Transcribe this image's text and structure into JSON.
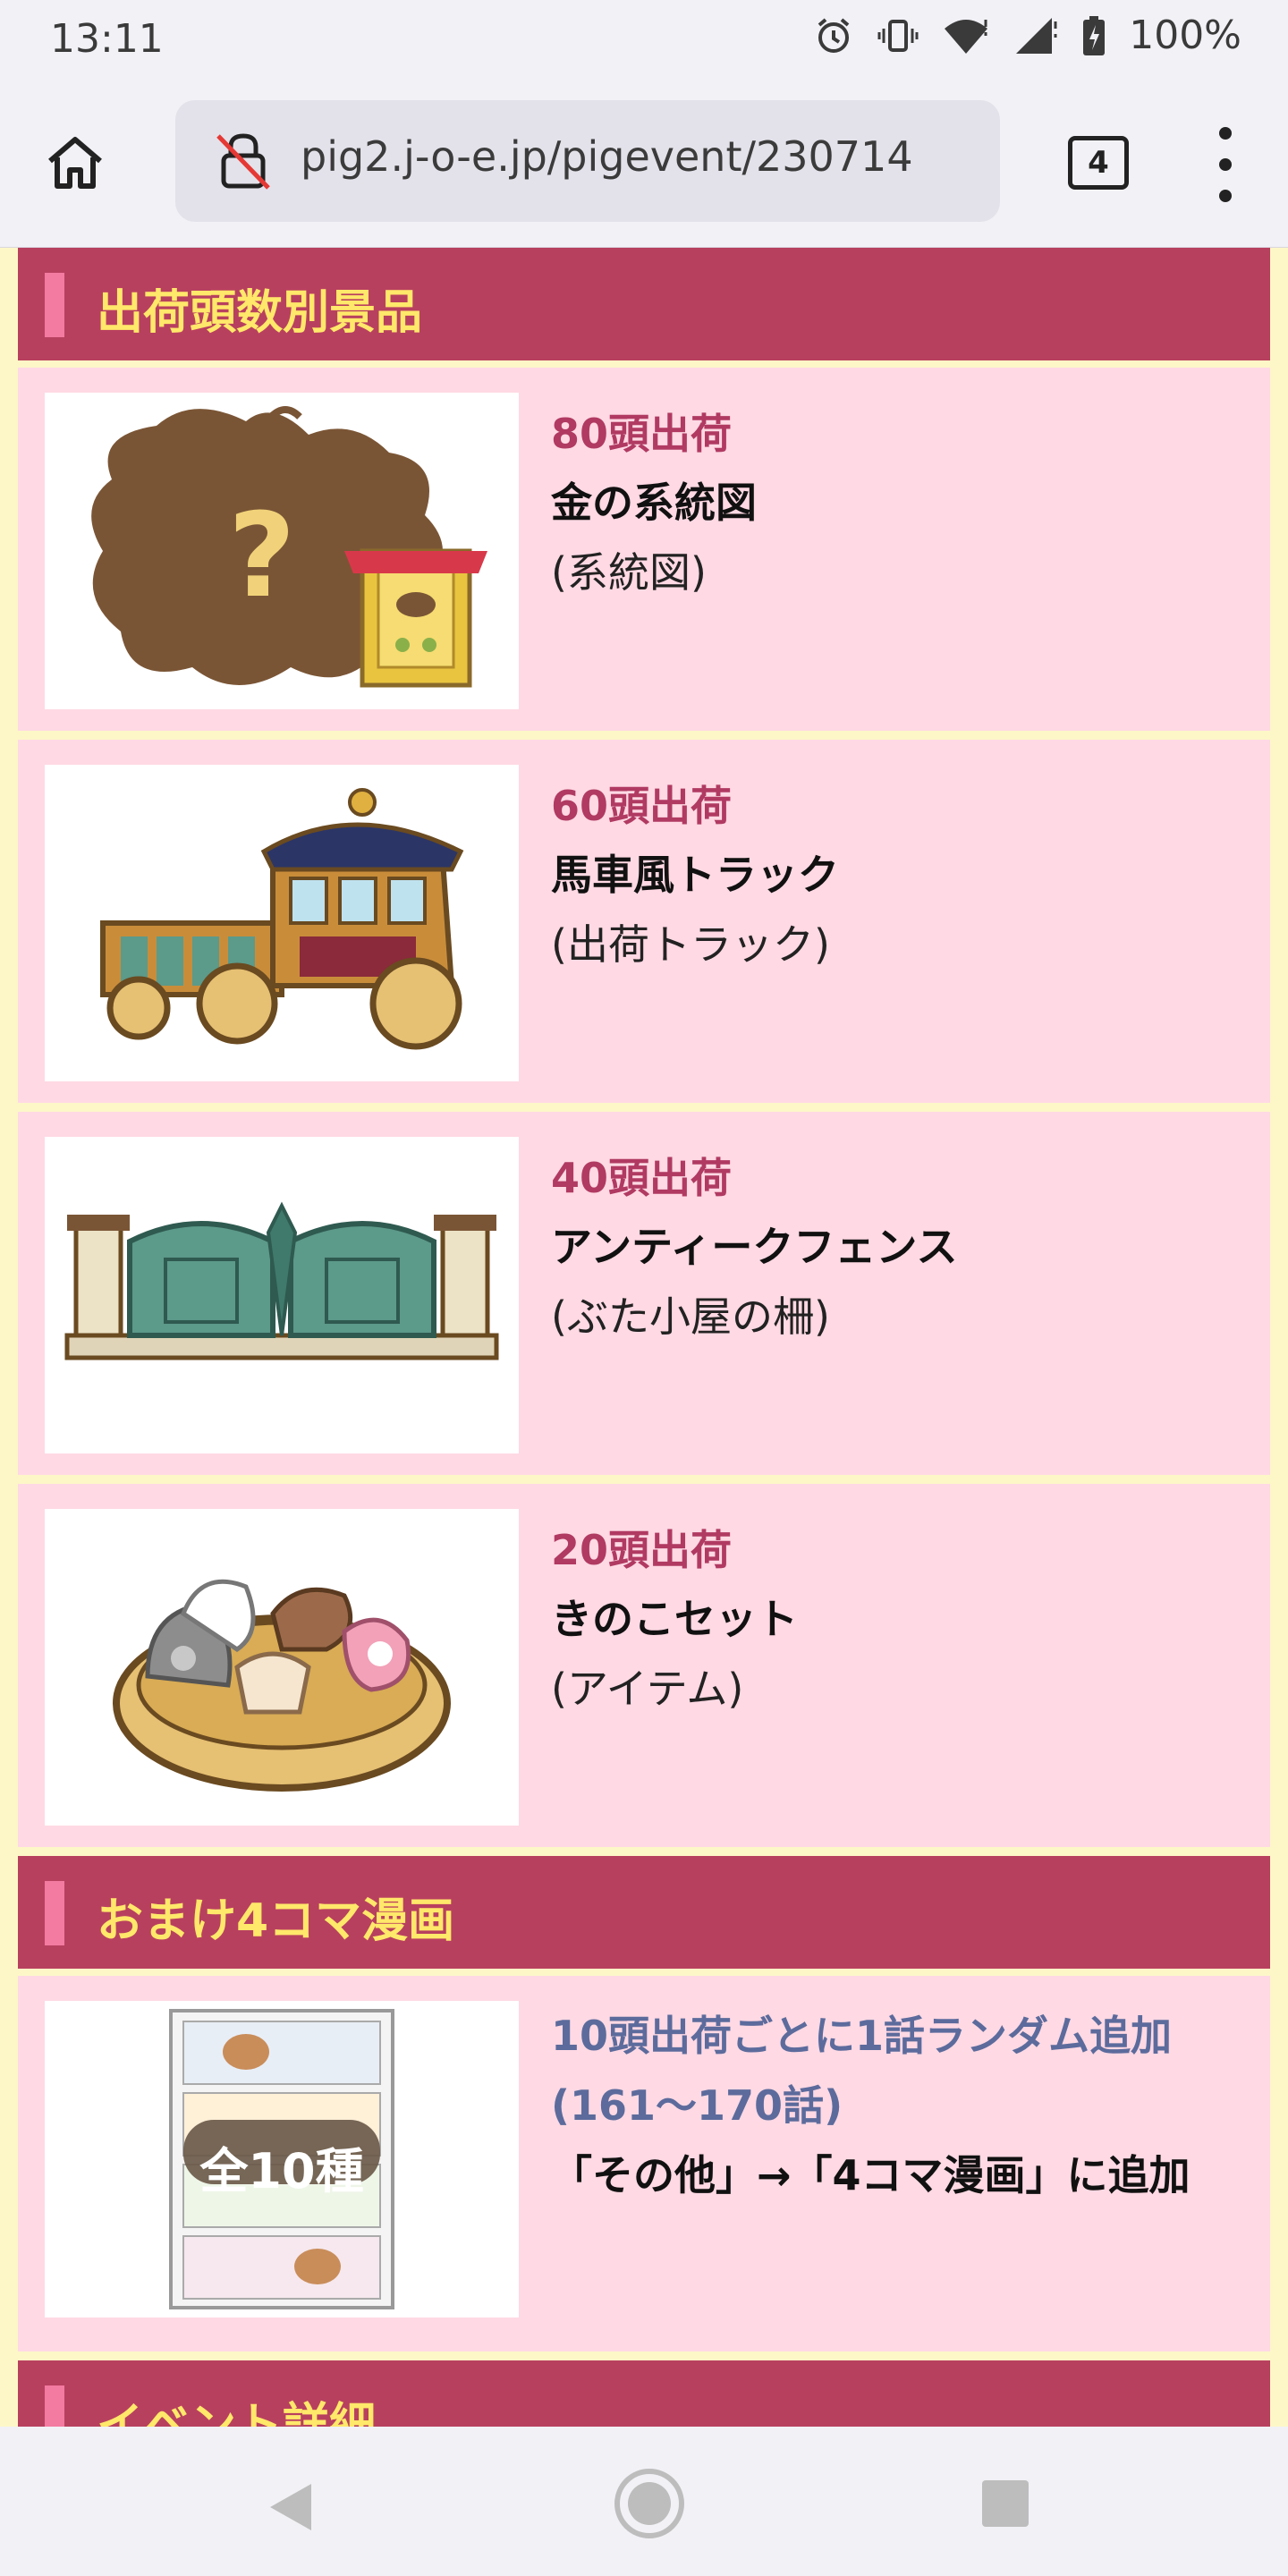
{
  "status_bar": {
    "time": "13:11",
    "battery": "100%",
    "icons": [
      "alarm-icon",
      "vibrate-icon",
      "wifi-icon",
      "signal-icon",
      "battery-charging-icon"
    ]
  },
  "browser": {
    "url": "pig2.j-o-e.jp/pigevent/230714",
    "tab_count": "4"
  },
  "sections": {
    "prizes_title": "出荷頭数別景品",
    "manga_title": "おまけ4コマ漫画",
    "details_title": "イベント詳細"
  },
  "prizes": [
    {
      "count": "80頭出荷",
      "name": "金の系統図",
      "category": "(系統図)",
      "image": "golden-family-tree-image"
    },
    {
      "count": "60頭出荷",
      "name": "馬車風トラック",
      "category": "(出荷トラック)",
      "image": "carriage-truck-image"
    },
    {
      "count": "40頭出荷",
      "name": "アンティークフェンス",
      "category": "(ぶた小屋の柵)",
      "image": "antique-fence-image"
    },
    {
      "count": "20頭出荷",
      "name": "きのこセット",
      "category": "(アイテム)",
      "image": "mushroom-set-image"
    }
  ],
  "manga": {
    "badge": "全10種",
    "line1": "10頭出荷ごとに1話ランダム追加",
    "line2": "(161〜170話)",
    "line3": "「その他」→「4コマ漫画」に追加"
  },
  "colors": {
    "header_bg": "#b8405f",
    "header_text": "#ffe86a",
    "row_bg": "#ffd9e4",
    "count_text": "#b03a62",
    "manga_text": "#5c6b9c"
  }
}
